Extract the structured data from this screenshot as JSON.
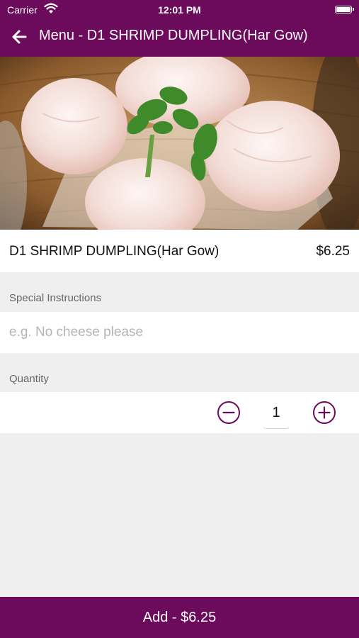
{
  "status_bar": {
    "carrier": "Carrier",
    "time": "12:01 PM",
    "wifi_icon": "wifi-icon",
    "battery_icon": "battery-icon"
  },
  "nav": {
    "back_icon": "arrow-left-icon",
    "title": "Menu - D1 SHRIMP DUMPLING(Har Gow)"
  },
  "item": {
    "name": "D1 SHRIMP DUMPLING(Har Gow)",
    "price": "$6.25"
  },
  "special_instructions": {
    "label": "Special Instructions",
    "value": "",
    "placeholder": "e.g. No cheese please"
  },
  "quantity": {
    "label": "Quantity",
    "value": "1",
    "decrement_icon": "minus-circle-icon",
    "increment_icon": "plus-circle-icon"
  },
  "add_button": {
    "label": "Add - $6.25"
  },
  "colors": {
    "brand": "#6c0a5c",
    "background": "#efefef"
  }
}
